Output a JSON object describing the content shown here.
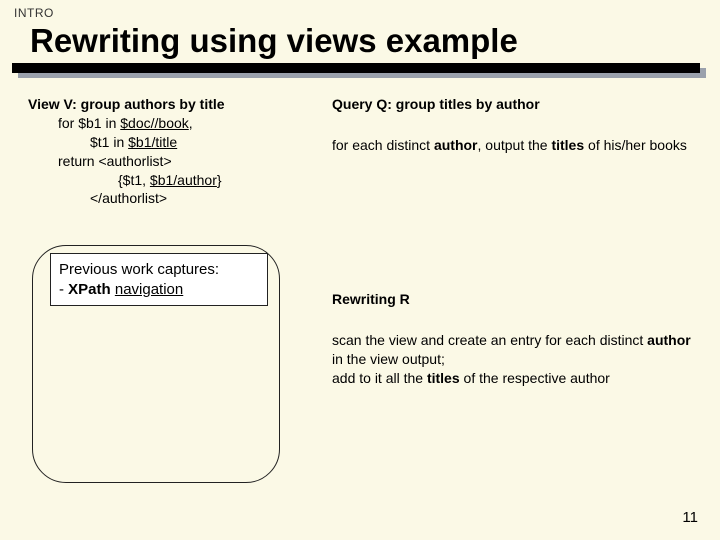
{
  "section": "INTRO",
  "title": "Rewriting using views example",
  "view": {
    "head": "View V: group authors by title",
    "l1a": "for $b1 in ",
    "l1b": "$doc//book",
    "l1c": ",",
    "l2a": "$t1 in ",
    "l2b": "$b1/title",
    "l3": "return <authorlist>",
    "l4a": "{$t1, ",
    "l4b": "$b1/author",
    "l4c": "}",
    "l5": "</authorlist>"
  },
  "query": {
    "head": "Query Q: group titles by author",
    "body_a": "for each distinct ",
    "body_b": "author",
    "body_c": ", output the ",
    "body_d": "titles",
    "body_e": " of his/her books"
  },
  "rewriting": {
    "head": "Rewriting R",
    "r1a": "scan the view and create an entry for each distinct ",
    "r1b": "author",
    "r1c": " in the view output;",
    "r2a": "add to it all the ",
    "r2b": "titles",
    "r2c": " of the respective author"
  },
  "prev": {
    "l1": "Previous work captures:",
    "l2a": "- ",
    "l2b": "XPath",
    "l2c": " ",
    "l2d": "navigation"
  },
  "page": "11"
}
